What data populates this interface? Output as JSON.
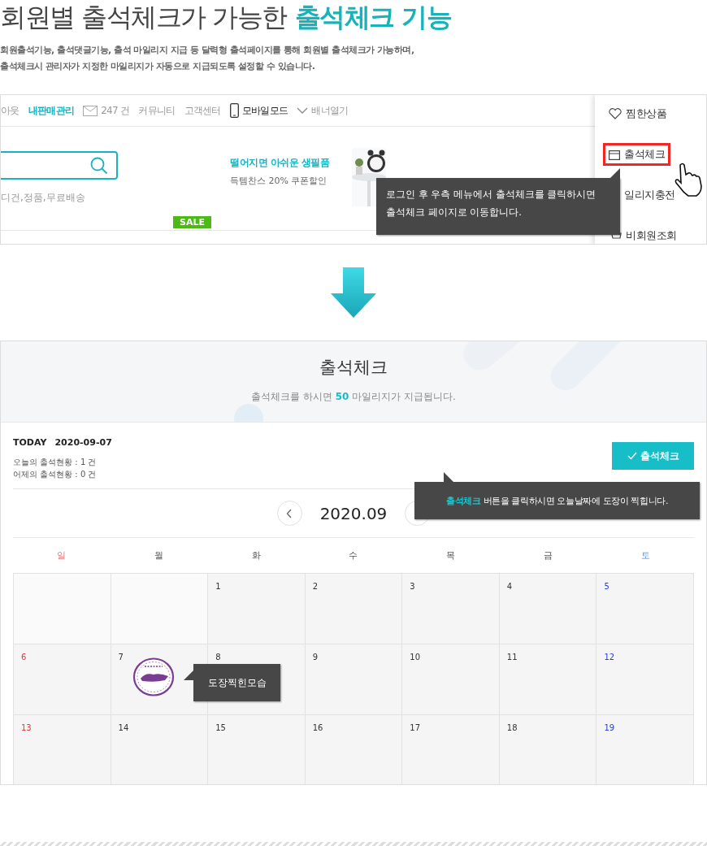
{
  "heading": {
    "plain": "회원별 출석체크가 가능한",
    "accent": "출석체크 기능"
  },
  "description": [
    "회원출석기능, 출석댓글기능, 출석 마일리지 지급 등 달력형 출석페이지를 통해 회원별 출석체크가 가능하며,",
    "출석체크시 관리자가 지정한 마일리지가 자동으로 지급되도록 설정할 수 있습니다."
  ],
  "shop": {
    "nav": [
      {
        "kind": "text",
        "label": "아웃"
      },
      {
        "kind": "link",
        "label": "내판매관리"
      },
      {
        "kind": "mail",
        "label": "247 건"
      },
      {
        "kind": "text",
        "label": "커뮤니티"
      },
      {
        "kind": "text",
        "label": "고객센터"
      },
      {
        "kind": "mobile",
        "label": "모바일모드"
      },
      {
        "kind": "banner",
        "label": "배너열기"
      }
    ],
    "search_tags": "디건,정품,무료배송",
    "banner": {
      "title": "떨어지면 아쉬운 생필품",
      "subtitle": "득템찬스 20% 쿠폰할인"
    },
    "sale_badge": "SALE",
    "side_menu": [
      {
        "kind": "heart",
        "label": "찜한상품",
        "selected": false
      },
      {
        "kind": "calendar",
        "label": "출석체크",
        "selected": true
      },
      {
        "kind": "coin",
        "label": "일리지충전",
        "selected": false
      },
      {
        "kind": "cart",
        "label": "비회원조회",
        "selected": false
      }
    ],
    "tooltip": [
      "로그인 후 우측 메뉴에서 출석체크를 클릭하시면",
      "출석체크 페이지로 이동합니다."
    ]
  },
  "attendance": {
    "title": "출석체크",
    "subtitle_before": "출석체크를 하시면",
    "amount": "50",
    "subtitle_after": "마일리지가 지급됩니다.",
    "today_label": "TODAY",
    "today_date": "2020-09-07",
    "stats": [
      "오늘의 출석현황 : 1 건",
      "어제의 출석현황 : 0 건"
    ],
    "check_button": "출석체크",
    "tooltip": {
      "accent": "출석체크",
      "text": "버튼을 클릭하시면 오늘날짜에 도장이 찍힙니다."
    },
    "month": "2020.09",
    "weekdays": [
      {
        "label": "일",
        "kind": "sunday"
      },
      {
        "label": "월",
        "kind": "weekday"
      },
      {
        "label": "화",
        "kind": "weekday"
      },
      {
        "label": "수",
        "kind": "weekday"
      },
      {
        "label": "목",
        "kind": "weekday"
      },
      {
        "label": "금",
        "kind": "weekday"
      },
      {
        "label": "토",
        "kind": "saturday"
      }
    ],
    "weeks": [
      [
        {
          "kind": "blank"
        },
        {
          "kind": "blank"
        },
        {
          "kind": "weekday",
          "day": "1",
          "stamped": false
        },
        {
          "kind": "weekday",
          "day": "2",
          "stamped": false
        },
        {
          "kind": "weekday",
          "day": "3",
          "stamped": false
        },
        {
          "kind": "weekday",
          "day": "4",
          "stamped": false
        },
        {
          "kind": "saturday",
          "day": "5",
          "stamped": false
        }
      ],
      [
        {
          "kind": "sunday",
          "day": "6",
          "stamped": false
        },
        {
          "kind": "weekday",
          "day": "7",
          "stamped": true
        },
        {
          "kind": "weekday",
          "day": "8",
          "stamped": false
        },
        {
          "kind": "weekday",
          "day": "9",
          "stamped": false
        },
        {
          "kind": "weekday",
          "day": "10",
          "stamped": false
        },
        {
          "kind": "weekday",
          "day": "11",
          "stamped": false
        },
        {
          "kind": "saturday",
          "day": "12",
          "stamped": false
        }
      ],
      [
        {
          "kind": "sunday",
          "day": "13",
          "stamped": false
        },
        {
          "kind": "weekday",
          "day": "14",
          "stamped": false
        },
        {
          "kind": "weekday",
          "day": "15",
          "stamped": false
        },
        {
          "kind": "weekday",
          "day": "16",
          "stamped": false
        },
        {
          "kind": "weekday",
          "day": "17",
          "stamped": false
        },
        {
          "kind": "weekday",
          "day": "18",
          "stamped": false
        },
        {
          "kind": "saturday",
          "day": "19",
          "stamped": false
        }
      ]
    ],
    "stamp_note": "도장찍힌모습"
  }
}
